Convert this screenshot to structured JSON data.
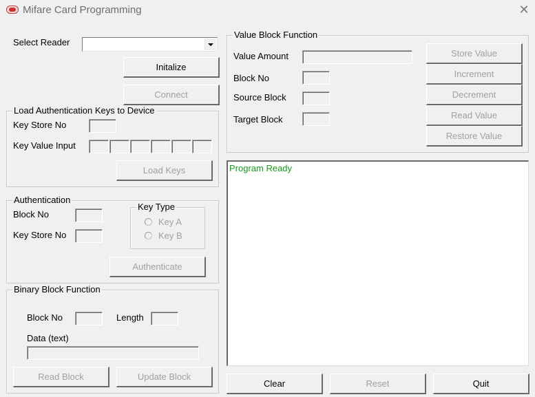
{
  "window": {
    "title": "Mifare Card Programming",
    "icon": "acs-logo-icon",
    "close_icon": "close-icon"
  },
  "reader": {
    "select_label": "Select Reader",
    "selected_value": "",
    "initialize_label": "Initalize",
    "connect_label": "Connect"
  },
  "load_keys": {
    "title": "Load Authentication Keys to Device",
    "key_store_label": "Key Store No",
    "key_store_value": "",
    "key_value_label": "Key Value Input",
    "key_values": [
      "",
      "",
      "",
      "",
      "",
      ""
    ],
    "load_button": "Load Keys"
  },
  "authentication": {
    "title": "Authentication",
    "block_label": "Block No",
    "block_value": "",
    "key_store_label": "Key Store No",
    "key_store_value": "",
    "key_type": {
      "title": "Key Type",
      "options": [
        "Key A",
        "Key B"
      ],
      "selected": null
    },
    "authenticate_button": "Authenticate"
  },
  "binary_block": {
    "title": "Binary Block Function",
    "block_label": "Block No",
    "block_value": "",
    "length_label": "Length",
    "length_value": "",
    "data_label": "Data (text)",
    "data_value": "",
    "read_button": "Read Block",
    "update_button": "Update Block"
  },
  "value_block": {
    "title": "Value Block Function",
    "amount_label": "Value Amount",
    "amount_value": "",
    "block_label": "Block No",
    "block_value": "",
    "source_label": "Source Block",
    "source_value": "",
    "target_label": "Target Block",
    "target_value": "",
    "buttons": [
      "Store Value",
      "Increment",
      "Decrement",
      "Read Value",
      "Restore Value"
    ]
  },
  "log": {
    "lines": [
      "Program Ready"
    ],
    "text_color": "#1a9a1a"
  },
  "footer": {
    "clear_label": "Clear",
    "reset_label": "Reset",
    "quit_label": "Quit"
  }
}
